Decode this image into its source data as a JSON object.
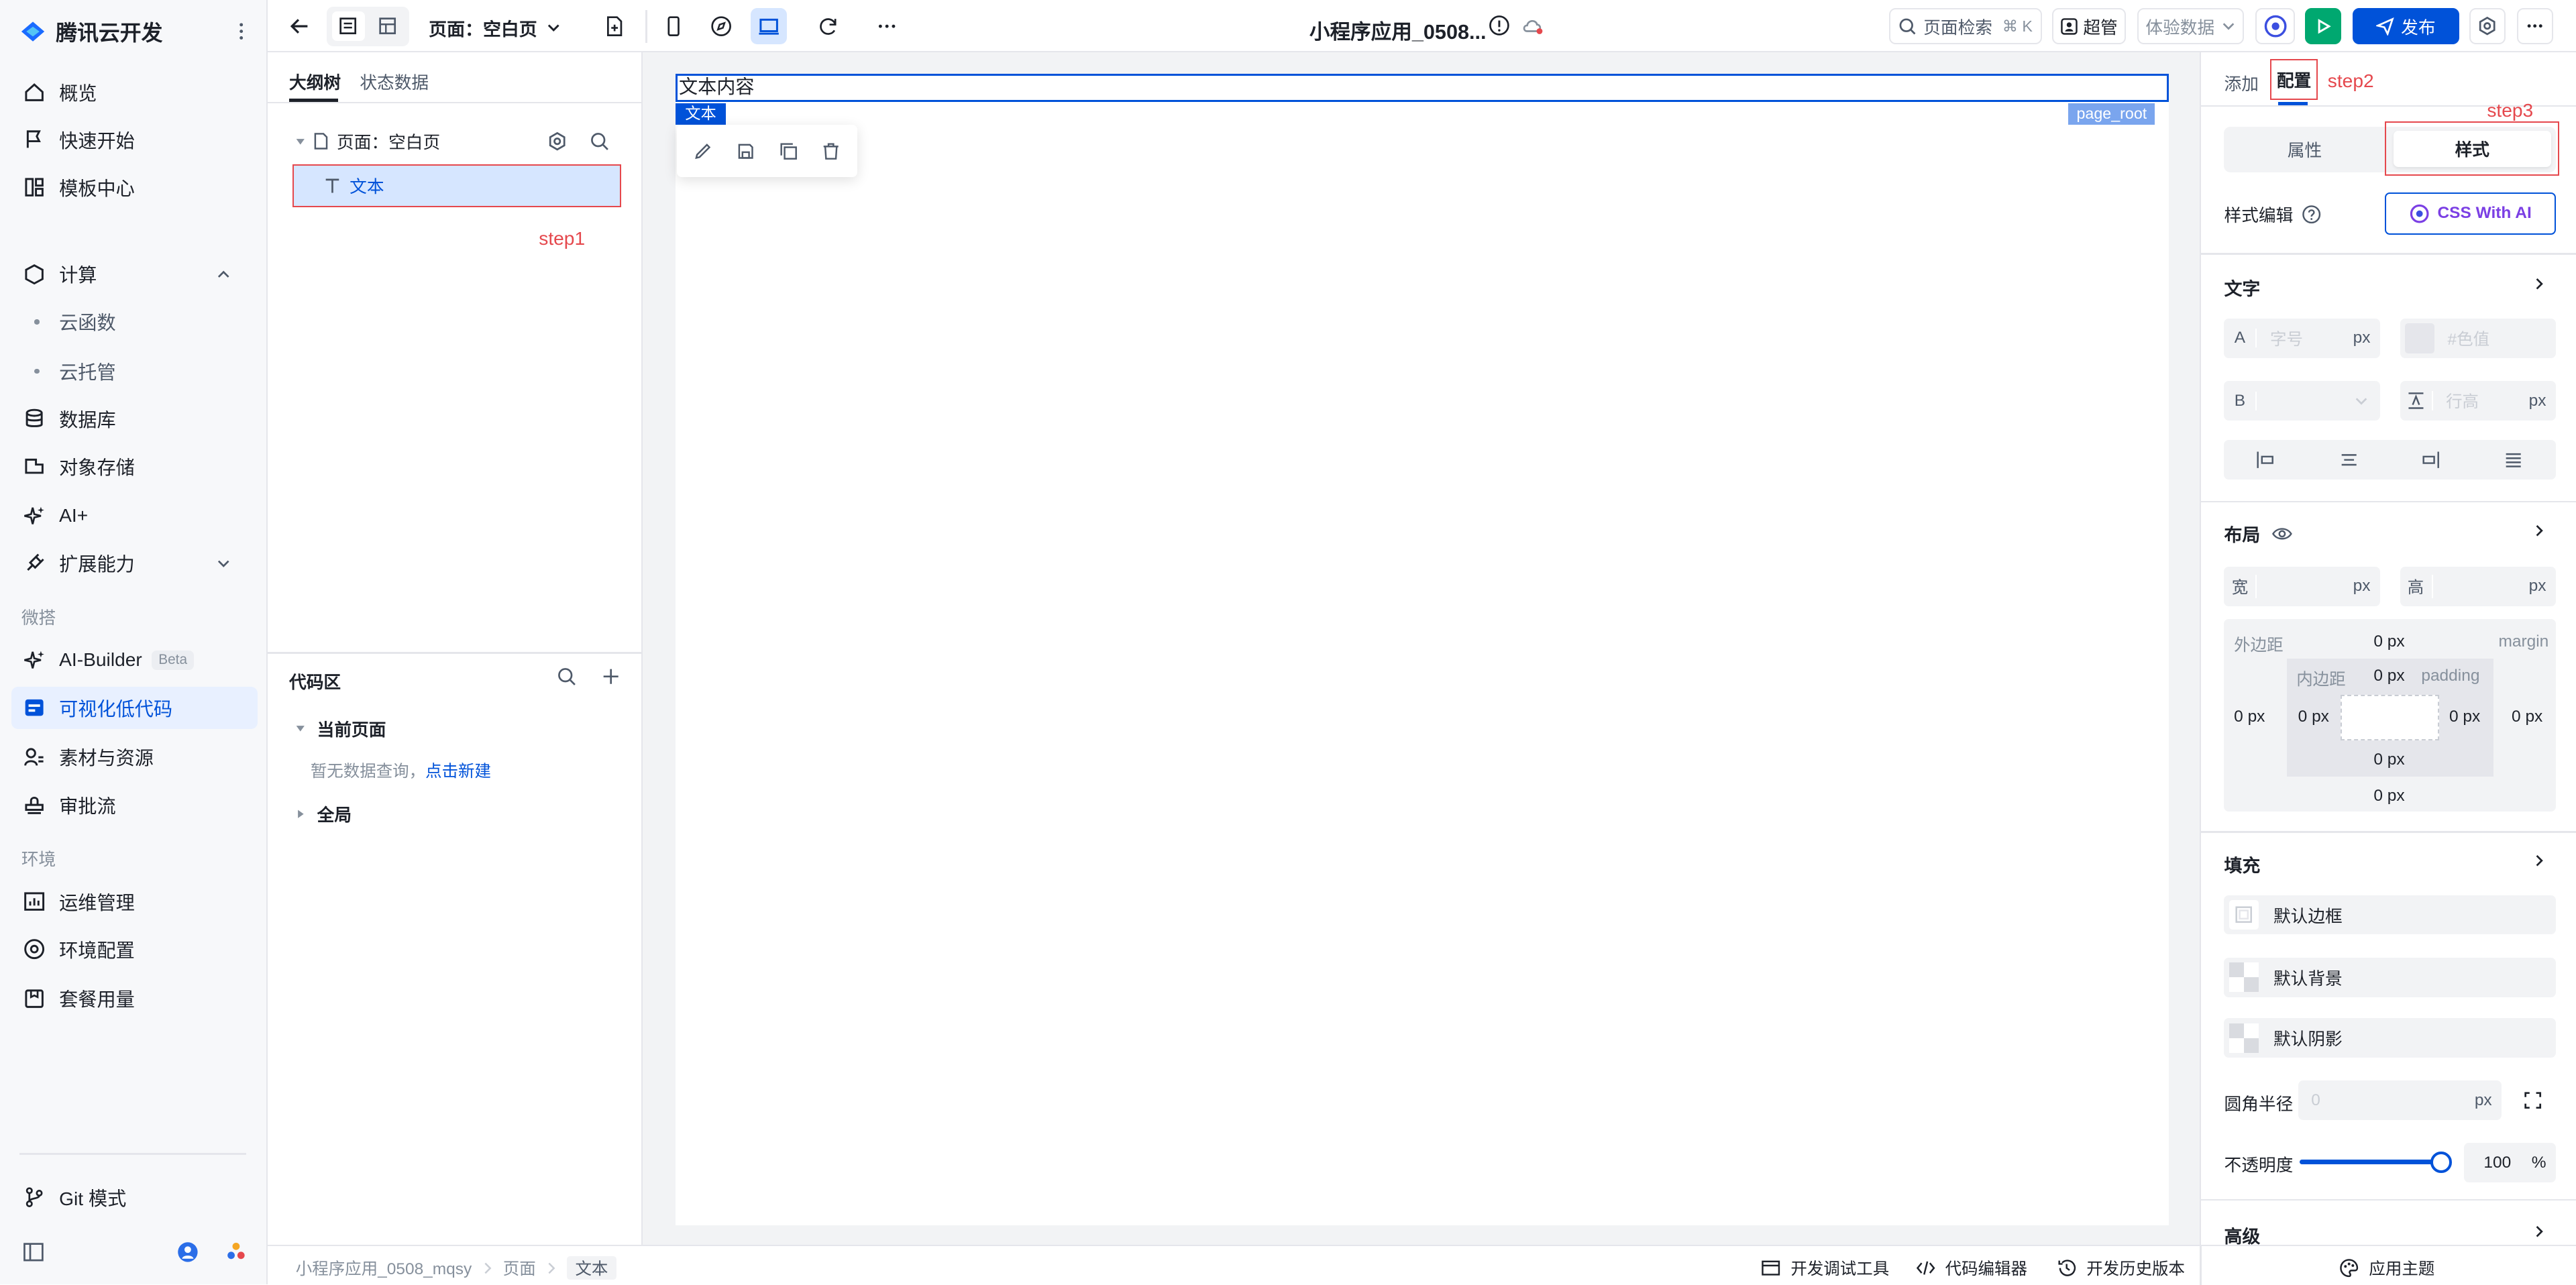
{
  "sidebar": {
    "brand": "腾讯云开发",
    "items": {
      "overview": "概览",
      "quickstart": "快速开始",
      "templates": "模板中心",
      "compute": "计算",
      "cloudfunc": "云函数",
      "cloudhost": "云托管",
      "database": "数据库",
      "storage": "对象存储",
      "ai": "AI+",
      "extend": "扩展能力",
      "aibuilder": "AI-Builder",
      "aibuilder_badge": "Beta",
      "lowcode": "可视化低代码",
      "assets": "素材与资源",
      "approval": "审批流",
      "ops": "运维管理",
      "envconfig": "环境配置",
      "usage": "套餐用量",
      "git": "Git 模式"
    },
    "sections": {
      "weida": "微搭",
      "env": "环境"
    }
  },
  "topbar": {
    "page_select": "页面：空白页",
    "app_title": "小程序应用_0508...",
    "search": "页面检索",
    "search_shortcut": "⌘ K",
    "admin": "超管",
    "experience": "体验数据",
    "publish": "发布"
  },
  "left_panel": {
    "tabs": [
      "大纲树",
      "状态数据"
    ],
    "tree_page": "页面：空白页",
    "tree_text": "文本",
    "step1": "step1",
    "code_title": "代码区",
    "current_page": "当前页面",
    "empty_hint": "暂无数据查询，",
    "create_link": "点击新建",
    "global": "全局"
  },
  "canvas": {
    "text_content": "文本内容",
    "tag_text": "文本",
    "tag_root": "page_root"
  },
  "right_panel": {
    "tabs": [
      "添加",
      "配置"
    ],
    "step2": "step2",
    "step3": "step3",
    "seg": [
      "属性",
      "样式"
    ],
    "style_edit": "样式编辑",
    "css_ai": "CSS With AI",
    "text_section": "文字",
    "font_size_prefix": "A",
    "font_size_ph": "字号",
    "unit_px": "px",
    "color_ph": "#色值",
    "bold_prefix": "B",
    "line_height_ph": "行高",
    "layout_section": "布局",
    "width_label": "宽",
    "height_label": "高",
    "margin_label": "外边距",
    "margin_en": "margin",
    "padding_label": "内边距",
    "padding_en": "padding",
    "zero_px": "0 px",
    "fill_section": "填充",
    "default_border": "默认边框",
    "default_bg": "默认背景",
    "default_shadow": "默认阴影",
    "radius_label": "圆角半径",
    "radius_ph": "0",
    "opacity_label": "不透明度",
    "opacity_value": "100",
    "opacity_unit": "%",
    "opacity_fraction": 1.0,
    "advanced": "高级"
  },
  "statusbar": {
    "breadcrumb": [
      "小程序应用_0508_mqsy",
      "页面",
      "文本"
    ],
    "devtools": "开发调试工具",
    "code_editor": "代码编辑器",
    "history": "开发历史版本",
    "theme": "应用主题"
  },
  "colors": {
    "primary": "#0052d9",
    "green": "#00a870",
    "highlight": "#e5484d",
    "selected_bg": "#d6e6ff"
  }
}
